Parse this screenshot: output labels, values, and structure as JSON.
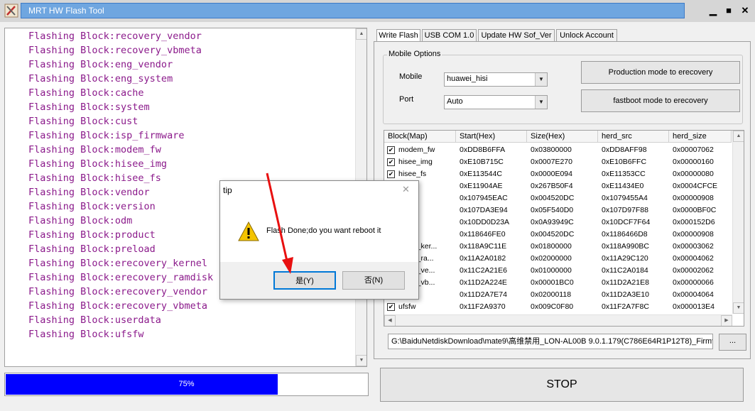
{
  "window": {
    "title": "MRT HW Flash Tool",
    "minimize": "▁",
    "maximize": "■",
    "close": "✕"
  },
  "log": {
    "lines": [
      "Flashing Block:recovery_vendor",
      "Flashing Block:recovery_vbmeta",
      "Flashing Block:eng_vendor",
      "Flashing Block:eng_system",
      "Flashing Block:cache",
      "Flashing Block:system",
      "Flashing Block:cust",
      "Flashing Block:isp_firmware",
      "Flashing Block:modem_fw",
      "Flashing Block:hisee_img",
      "Flashing Block:hisee_fs",
      "Flashing Block:vendor",
      "Flashing Block:version",
      "Flashing Block:odm",
      "Flashing Block:product",
      "Flashing Block:preload",
      "Flashing Block:erecovery_kernel",
      "Flashing Block:erecovery_ramdisk",
      "Flashing Block:erecovery_vendor",
      "Flashing Block:erecovery_vbmeta",
      "Flashing Block:userdata",
      "Flashing Block:ufsfw"
    ],
    "text_color": "#8b1a8b"
  },
  "progress": {
    "value": 0.75,
    "label": "75%",
    "color": "#0000ff"
  },
  "tabs": [
    "Write Flash",
    "USB COM 1.0",
    "Update HW Sof_Ver",
    "Unlock Account"
  ],
  "mobile_options": {
    "title": "Mobile Options",
    "mobile_label": "Mobile",
    "mobile_value": "huawei_hisi",
    "port_label": "Port",
    "port_value": "Auto",
    "btn_production": "Production mode to erecovery",
    "btn_fastboot": "fastboot mode to erecovery"
  },
  "table": {
    "columns": [
      "Block(Map)",
      "Start(Hex)",
      "Size(Hex)",
      "herd_src",
      "herd_size"
    ],
    "rows": [
      {
        "checked": true,
        "name": "modem_fw",
        "start": "0xDD8B6FFA",
        "size": "0x03800000",
        "src": "0xDD8AFF98",
        "hsize": "0x00007062"
      },
      {
        "checked": true,
        "name": "hisee_img",
        "start": "0xE10B715C",
        "size": "0x0007E270",
        "src": "0xE10B6FFC",
        "hsize": "0x00000160"
      },
      {
        "checked": true,
        "name": "hisee_fs",
        "start": "0xE113544C",
        "size": "0x0000E094",
        "src": "0xE11353CC",
        "hsize": "0x00000080"
      },
      {
        "checked": false,
        "name": "or",
        "start": "0xE11904AE",
        "size": "0x267B50F4",
        "src": "0xE11434E0",
        "hsize": "0x0004CFCE"
      },
      {
        "checked": false,
        "name": "n",
        "start": "0x107945EAC",
        "size": "0x004520DC",
        "src": "0x1079455A4",
        "hsize": "0x00000908"
      },
      {
        "checked": false,
        "name": "",
        "start": "0x107DA3E94",
        "size": "0x05F540D0",
        "src": "0x107D97F88",
        "hsize": "0x0000BF0C"
      },
      {
        "checked": false,
        "name": "ct",
        "start": "0x10DD0D23A",
        "size": "0x0A93949C",
        "src": "0x10DCF7F64",
        "hsize": "0x000152D6"
      },
      {
        "checked": false,
        "name": "ad",
        "start": "0x118646FE0",
        "size": "0x004520DC",
        "src": "0x1186466D8",
        "hsize": "0x00000908"
      },
      {
        "checked": false,
        "name": "overy_ker...",
        "start": "0x118A9C11E",
        "size": "0x01800000",
        "src": "0x118A990BC",
        "hsize": "0x00003062"
      },
      {
        "checked": false,
        "name": "overy_ra...",
        "start": "0x11A2A0182",
        "size": "0x02000000",
        "src": "0x11A29C120",
        "hsize": "0x00004062"
      },
      {
        "checked": false,
        "name": "overy_ve...",
        "start": "0x11C2A21E6",
        "size": "0x01000000",
        "src": "0x11C2A0184",
        "hsize": "0x00002062"
      },
      {
        "checked": false,
        "name": "overy_vb...",
        "start": "0x11D2A224E",
        "size": "0x00001BC0",
        "src": "0x11D2A21E8",
        "hsize": "0x00000066"
      },
      {
        "checked": false,
        "name": "ata",
        "start": "0x11D2A7E74",
        "size": "0x02000118",
        "src": "0x11D2A3E10",
        "hsize": "0x00004064"
      },
      {
        "checked": true,
        "name": "ufsfw",
        "start": "0x11F2A9370",
        "size": "0x009C0F80",
        "src": "0x11F2A7F8C",
        "hsize": "0x000013E4"
      }
    ]
  },
  "file_path": "G:\\BaiduNetdiskDownload\\mate9\\高维禁用_LON-AL00B 9.0.1.179(C786E64R1P12T8)_Firmv",
  "browse_label": "...",
  "stop_label": "STOP",
  "dialog": {
    "title": "tip",
    "message": "Flash Done;do you want reboot it",
    "yes_label": "是(Y)",
    "no_label": "否(N)"
  }
}
